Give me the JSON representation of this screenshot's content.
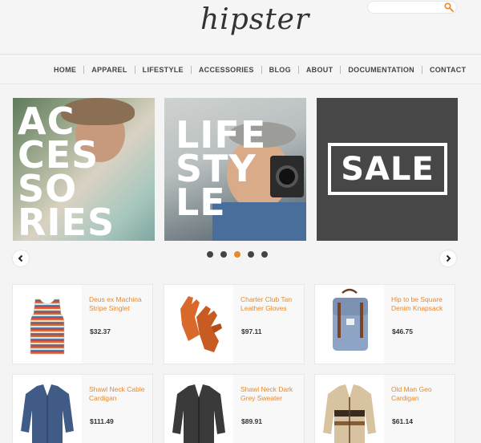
{
  "header": {
    "logo": "hipster",
    "search_placeholder": ""
  },
  "nav": {
    "items": [
      "HOME",
      "APPAREL",
      "LIFESTYLE",
      "ACCESSORIES",
      "BLOG",
      "ABOUT",
      "DOCUMENTATION",
      "CONTACT"
    ]
  },
  "slider": {
    "banners": [
      {
        "lines": [
          "AC",
          "CES",
          "SO",
          "RIES"
        ]
      },
      {
        "lines": [
          "LIFE",
          "STY",
          "LE"
        ]
      },
      {
        "label": "SALE"
      }
    ],
    "dot_count": 5,
    "active_dot": 3
  },
  "products": [
    {
      "name": "Deus ex Machina Stripe Singlet",
      "price": "$32.37",
      "icon": "striped-tank-top-icon"
    },
    {
      "name": "Charter Club Tan Leather Gloves",
      "price": "$97.11",
      "icon": "leather-gloves-icon"
    },
    {
      "name": "Hip to be Square Denim Knapsack",
      "price": "$46.75",
      "icon": "denim-backpack-icon"
    },
    {
      "name": "Shawl Neck Cable Cardigan",
      "price": "$111.49",
      "icon": "navy-cardigan-icon"
    },
    {
      "name": "Shawl Neck Dark Grey Sweater",
      "price": "$89.91",
      "icon": "dark-grey-sweater-icon"
    },
    {
      "name": "Old Man Geo Cardigan",
      "price": "$61.14",
      "icon": "geo-cardigan-icon"
    }
  ],
  "colors": {
    "accent": "#e8892b",
    "text": "#444444",
    "sale_bg": "#474747"
  }
}
